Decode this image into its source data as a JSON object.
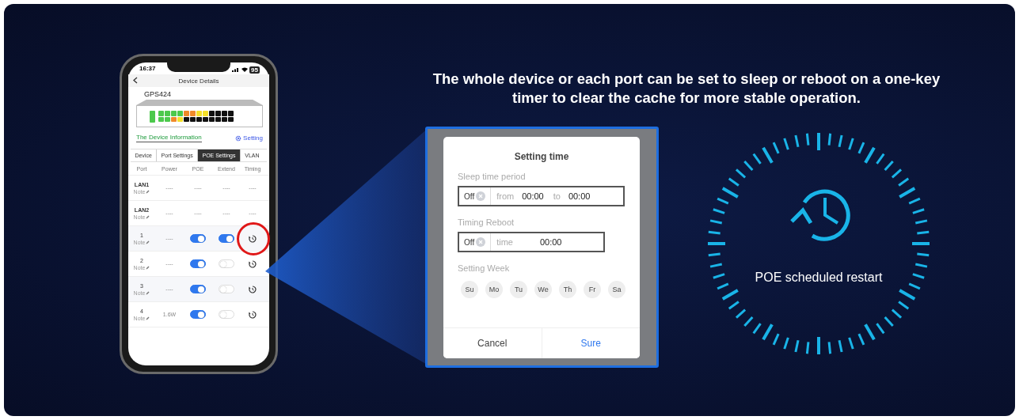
{
  "headline": "The whole device or each port can be set to sleep or reboot on a one-key timer to clear the cache for more stable operation.",
  "phone": {
    "time": "16:37",
    "battery": "95",
    "title": "Device Details",
    "device_name": "GPS424",
    "lead_port": {
      "color": "#4cc94c"
    },
    "ports_top": [
      {
        "color": "#4cc94c"
      },
      {
        "color": "#4cc94c"
      },
      {
        "color": "#4cc94c"
      },
      {
        "color": "#4cc94c"
      },
      {
        "color": "#f08a2a"
      },
      {
        "color": "#f08a2a"
      },
      {
        "color": "#f5e02a"
      },
      {
        "color": "#f5e02a"
      },
      {
        "color": "#111111"
      },
      {
        "color": "#111111"
      },
      {
        "color": "#111111"
      },
      {
        "color": "#111111"
      }
    ],
    "ports_bottom": [
      {
        "color": "#4cc94c"
      },
      {
        "color": "#4cc94c"
      },
      {
        "color": "#f08a2a"
      },
      {
        "color": "#f5e02a"
      },
      {
        "color": "#111111"
      },
      {
        "color": "#111111"
      },
      {
        "color": "#111111"
      },
      {
        "color": "#111111"
      },
      {
        "color": "#111111"
      },
      {
        "color": "#111111"
      },
      {
        "color": "#111111"
      },
      {
        "color": "#111111"
      }
    ],
    "info_link": "The Device Information",
    "setting_link": "Setting",
    "tabs": [
      {
        "label": "Device",
        "selected": false
      },
      {
        "label": "Port Settings",
        "selected": false
      },
      {
        "label": "POE Settings",
        "selected": true
      },
      {
        "label": "VLAN",
        "selected": false
      }
    ],
    "columns": [
      "Port",
      "Power",
      "POE",
      "Extend",
      "Timing"
    ],
    "rows": [
      {
        "kind": "lan",
        "port": "LAN1",
        "note": "Note",
        "power": "----",
        "poe": "----",
        "extend": "----",
        "timing": "----"
      },
      {
        "kind": "lan",
        "port": "LAN2",
        "note": "Note",
        "power": "----",
        "poe": "----",
        "extend": "----",
        "timing": "----"
      },
      {
        "kind": "port",
        "port": "1",
        "note": "Note",
        "power": "----",
        "poe_on": true,
        "extend_on": true,
        "highlighted": true
      },
      {
        "kind": "port",
        "port": "2",
        "note": "Note",
        "power": "----",
        "poe_on": true,
        "extend_on": false
      },
      {
        "kind": "port",
        "port": "3",
        "note": "Note",
        "power": "----",
        "poe_on": true,
        "extend_on": false
      },
      {
        "kind": "port",
        "port": "4",
        "note": "Note",
        "power": "1.6W",
        "poe_on": true,
        "extend_on": false
      }
    ]
  },
  "dialog": {
    "title": "Setting time",
    "sleep": {
      "label": "Sleep time period",
      "state": "Off",
      "from_label": "from",
      "from": "00:00",
      "to_label": "to",
      "to": "00:00"
    },
    "reboot": {
      "label": "Timing Reboot",
      "state": "Off",
      "time_label": "time",
      "time": "00:00"
    },
    "week": {
      "label": "Setting Week",
      "days": [
        {
          "label": "Su",
          "selected": false
        },
        {
          "label": "Mo",
          "selected": false
        },
        {
          "label": "Tu",
          "selected": false
        },
        {
          "label": "We",
          "selected": false
        },
        {
          "label": "Th",
          "selected": false
        },
        {
          "label": "Fr",
          "selected": false
        },
        {
          "label": "Sa",
          "selected": false
        }
      ]
    },
    "buttons": [
      "Cancel",
      "Sure"
    ]
  },
  "clock": {
    "caption": "POE scheduled restart"
  }
}
